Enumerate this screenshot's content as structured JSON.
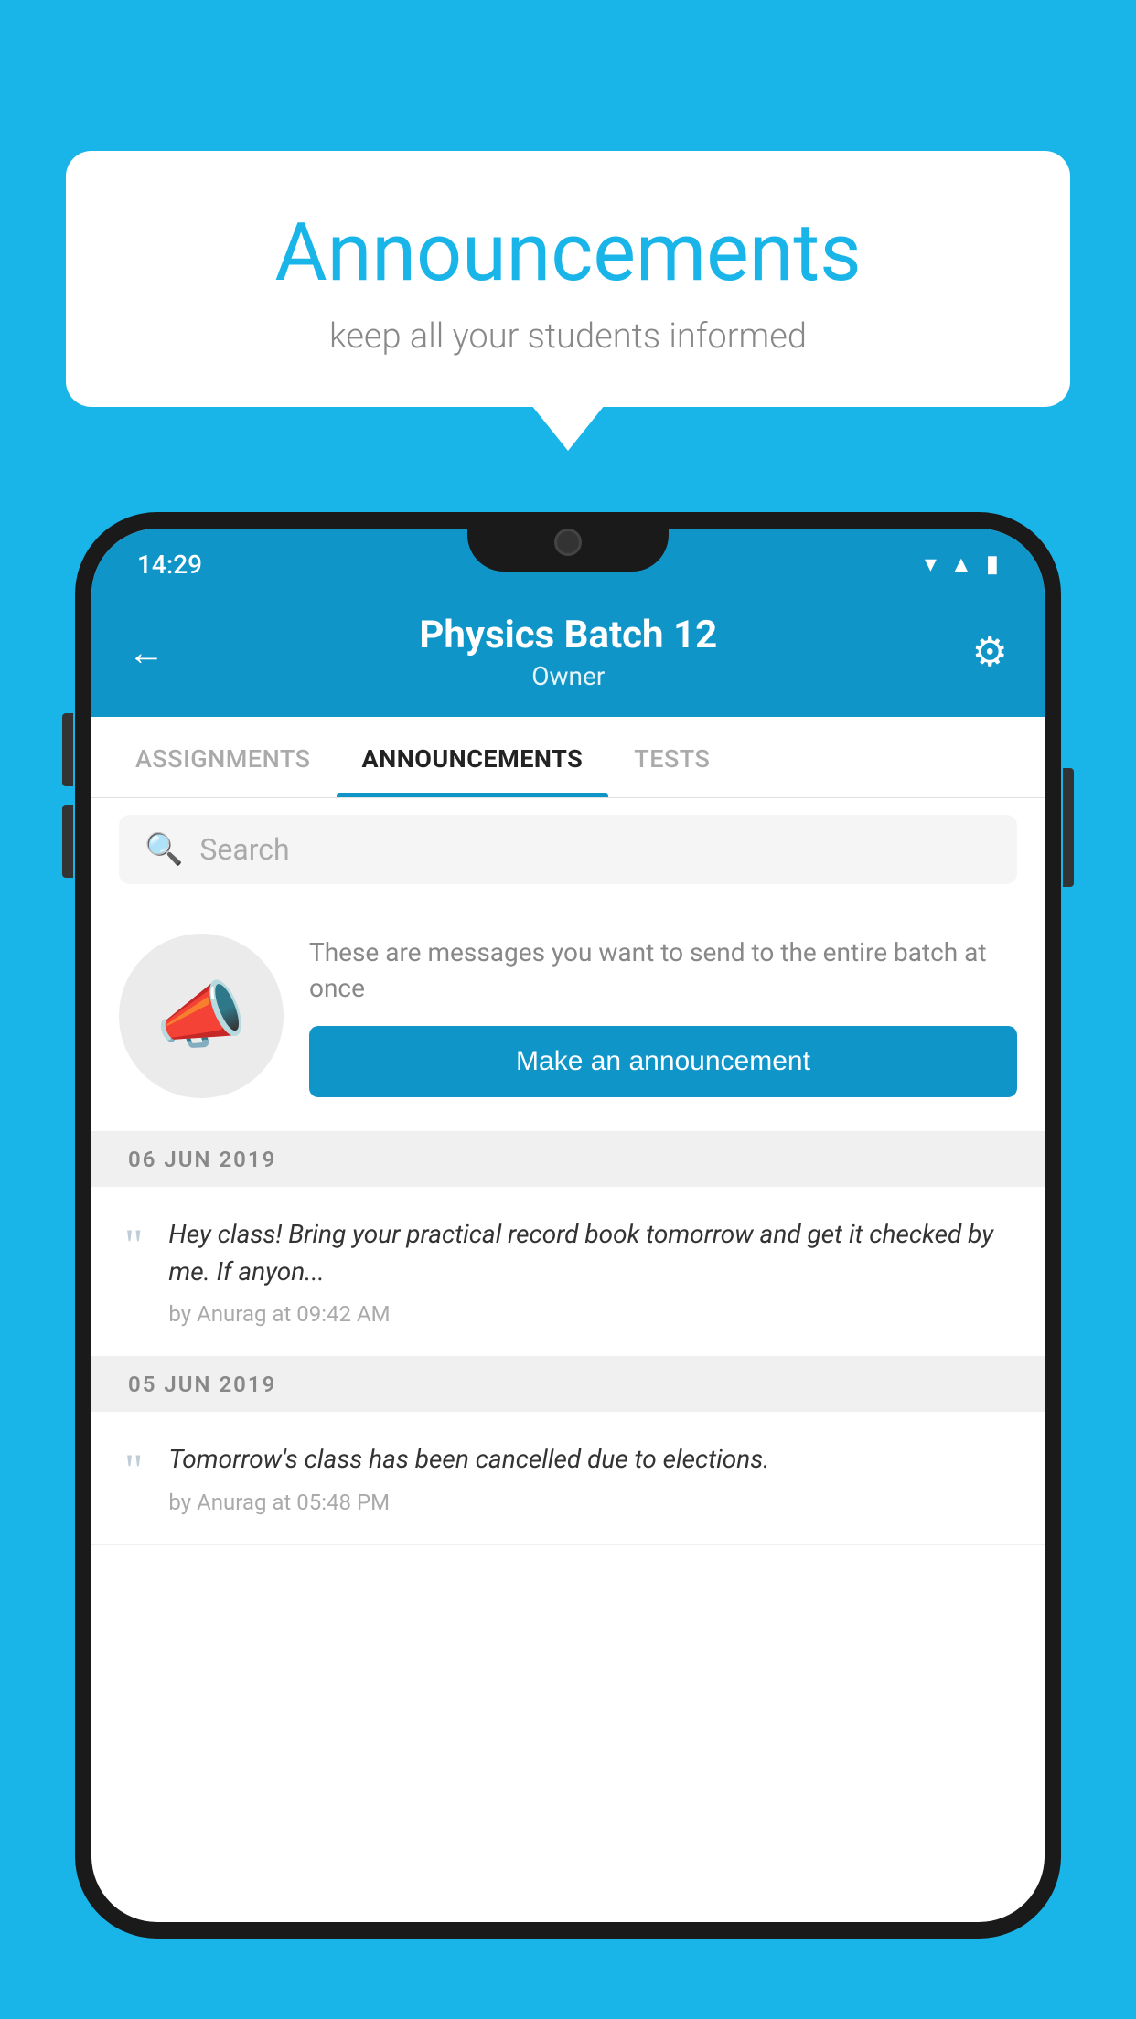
{
  "bubble": {
    "title": "Announcements",
    "subtitle": "keep all your students informed"
  },
  "status_bar": {
    "time": "14:29",
    "icons": [
      "wifi",
      "signal",
      "battery"
    ]
  },
  "header": {
    "title": "Physics Batch 12",
    "subtitle": "Owner",
    "back_label": "←",
    "gear_label": "⚙"
  },
  "tabs": [
    {
      "label": "ASSIGNMENTS",
      "active": false
    },
    {
      "label": "ANNOUNCEMENTS",
      "active": true
    },
    {
      "label": "TESTS",
      "active": false
    },
    {
      "label": "...",
      "active": false
    }
  ],
  "search": {
    "placeholder": "Search"
  },
  "prompt": {
    "text": "These are messages you want to send to the entire batch at once",
    "button_label": "Make an announcement"
  },
  "announcements": [
    {
      "date": "06  JUN  2019",
      "text": "Hey class! Bring your practical record book tomorrow and get it checked by me. If anyon...",
      "meta": "by Anurag at 09:42 AM"
    },
    {
      "date": "05  JUN  2019",
      "text": "Tomorrow's class has been cancelled due to elections.",
      "meta": "by Anurag at 05:48 PM"
    }
  ]
}
